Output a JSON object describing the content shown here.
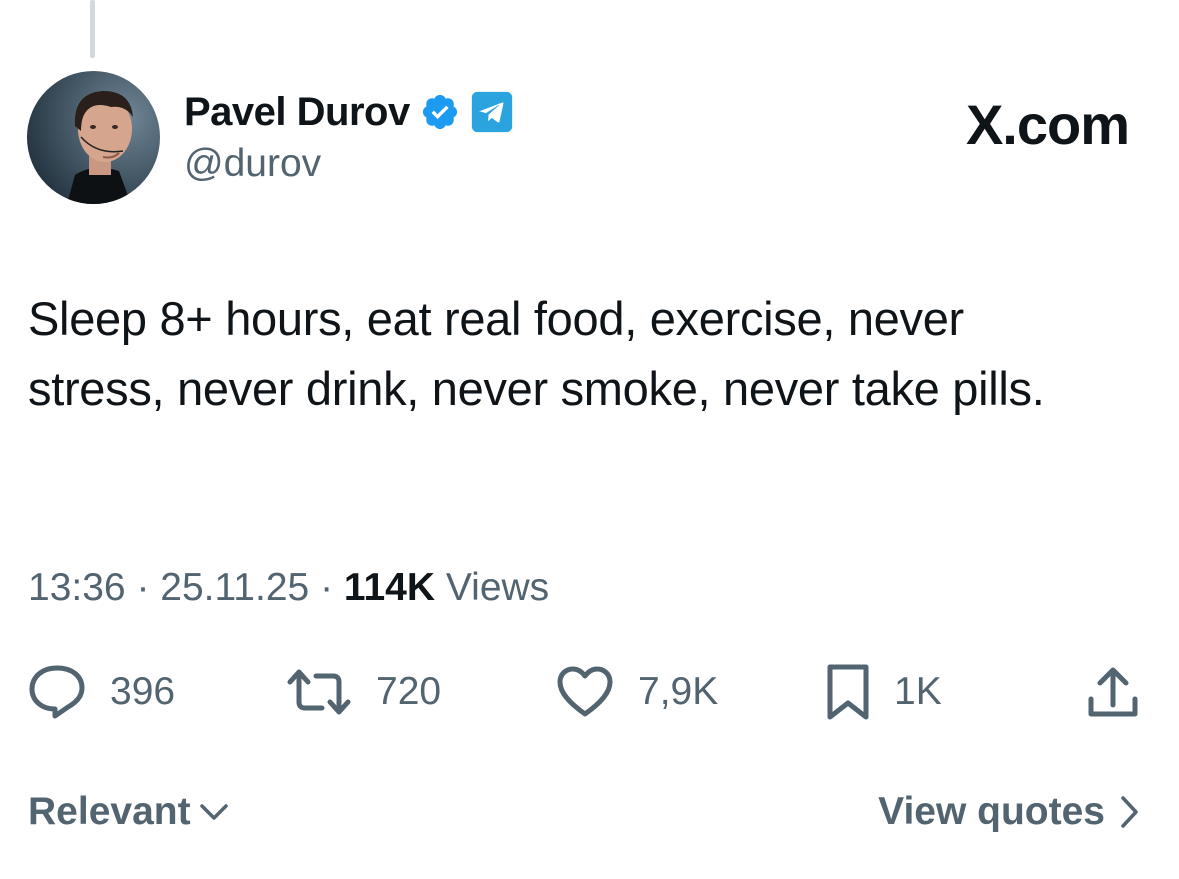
{
  "author": {
    "name": "Pavel Durov",
    "handle": "@durov",
    "verified_color": "#1d9bf0",
    "telegram_color": "#2aa3df"
  },
  "brand": {
    "label": "X.com"
  },
  "tweet": {
    "text": "Sleep 8+ hours, eat real food, exercise, never stress, never drink, never smoke, never take pills.",
    "time": "13:36",
    "date": "25.11.25",
    "views_count": "114K",
    "views_label": "Views",
    "separator": "·"
  },
  "actions": {
    "replies": "396",
    "reposts": "720",
    "likes": "7,9K",
    "bookmarks": "1K"
  },
  "footer": {
    "sort_label": "Relevant",
    "quotes_label": "View quotes"
  },
  "icons": {
    "reply": "reply-icon",
    "repost": "repost-icon",
    "like": "heart-icon",
    "bookmark": "bookmark-icon",
    "share": "share-icon",
    "verified": "verified-badge-icon",
    "telegram": "telegram-icon"
  }
}
